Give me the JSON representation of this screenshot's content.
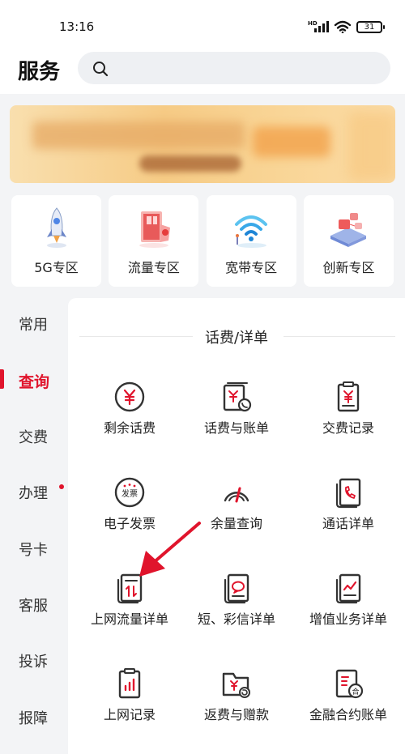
{
  "status_bar": {
    "time": "13:16",
    "network": "HD",
    "battery": "31"
  },
  "header": {
    "title": "服务"
  },
  "quick_entries": [
    {
      "label": "5G专区",
      "icon": "rocket-icon"
    },
    {
      "label": "流量专区",
      "icon": "flow-door-icon"
    },
    {
      "label": "宽带专区",
      "icon": "wifi-icon"
    },
    {
      "label": "创新专区",
      "icon": "innovation-platform-icon"
    }
  ],
  "sidebar": {
    "items": [
      {
        "label": "常用"
      },
      {
        "label": "查询",
        "active": true
      },
      {
        "label": "交费"
      },
      {
        "label": "办理",
        "badge_dot": true
      },
      {
        "label": "号卡"
      },
      {
        "label": "客服"
      },
      {
        "label": "投诉"
      },
      {
        "label": "报障"
      }
    ]
  },
  "section": {
    "title": "话费/详单",
    "items": [
      {
        "label": "剩余话费",
        "icon": "yuan-circle-icon"
      },
      {
        "label": "话费与账单",
        "icon": "bill-phone-icon"
      },
      {
        "label": "交费记录",
        "icon": "receipt-yuan-icon"
      },
      {
        "label": "电子发票",
        "icon": "e-invoice-icon",
        "icon_text": "发票"
      },
      {
        "label": "余量查询",
        "icon": "gauge-icon"
      },
      {
        "label": "通话详单",
        "icon": "call-detail-icon"
      },
      {
        "label": "上网流量详单",
        "icon": "data-detail-icon"
      },
      {
        "label": "短、彩信详单",
        "icon": "sms-detail-icon"
      },
      {
        "label": "增值业务详单",
        "icon": "value-added-icon"
      },
      {
        "label": "上网记录",
        "icon": "clipboard-chart-icon"
      },
      {
        "label": "返费与赠款",
        "icon": "folder-yuan-icon"
      },
      {
        "label": "金融合约账单",
        "icon": "contract-bill-icon",
        "icon_text": "合"
      }
    ]
  },
  "colors": {
    "accent": "#e0142c",
    "background": "#f3f4f6",
    "icon_stroke": "#333333"
  }
}
